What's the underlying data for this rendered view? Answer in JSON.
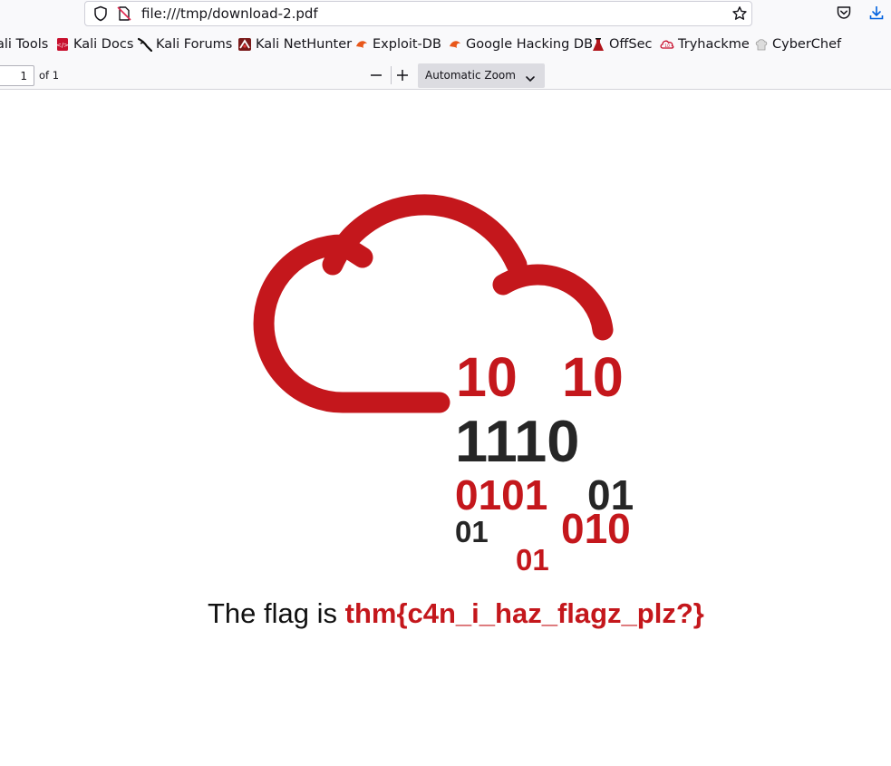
{
  "browser": {
    "url": "file:///tmp/download-2.pdf"
  },
  "bookmarks": [
    {
      "label": "ali Tools",
      "icon": "kali-tools-icon"
    },
    {
      "label": "Kali Docs",
      "icon": "kali-docs-icon"
    },
    {
      "label": "Kali Forums",
      "icon": "kali-forums-icon"
    },
    {
      "label": "Kali NetHunter",
      "icon": "kali-nethunter-icon"
    },
    {
      "label": "Exploit-DB",
      "icon": "exploit-db-icon"
    },
    {
      "label": "Google Hacking DB",
      "icon": "google-hacking-db-icon"
    },
    {
      "label": "OffSec",
      "icon": "offsec-icon"
    },
    {
      "label": "Tryhackme",
      "icon": "tryhackme-icon"
    },
    {
      "label": "CyberChef",
      "icon": "cyberchef-icon"
    }
  ],
  "pdf_toolbar": {
    "page_number": "1",
    "page_count": "of 1",
    "zoom": "Automatic Zoom"
  },
  "document": {
    "binary_digits": [
      "10",
      "10",
      "1110",
      "0101",
      "01",
      "01",
      "010",
      "01"
    ],
    "caption_prefix": "The flag is ",
    "flag": "thm{c4n_i_haz_flagz_plz?}"
  },
  "colors": {
    "accent_red": "#c4171c",
    "digit_dark": "#262626"
  }
}
